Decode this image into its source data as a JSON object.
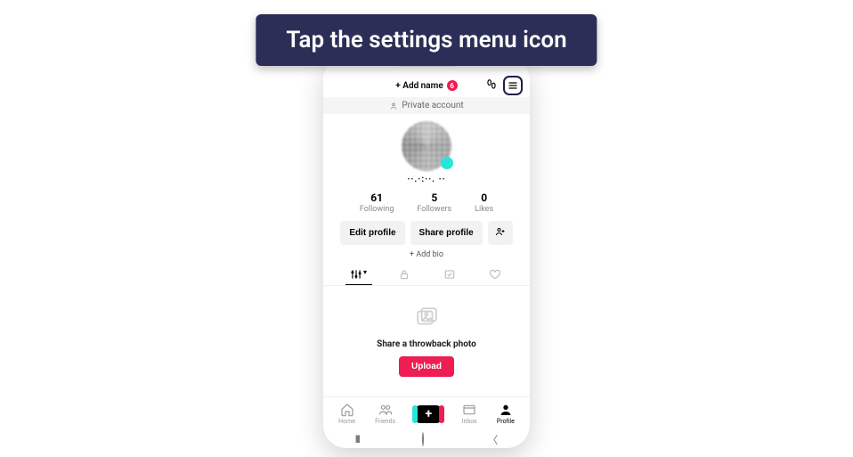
{
  "instruction": "Tap the settings menu icon",
  "header": {
    "add_name_label": "+ Add name",
    "badge_count": "6"
  },
  "private_label": "Private account",
  "username": "··.·:··. ··",
  "stats": {
    "following": {
      "num": "61",
      "label": "Following"
    },
    "followers": {
      "num": "5",
      "label": "Followers"
    },
    "likes": {
      "num": "0",
      "label": "Likes"
    }
  },
  "actions": {
    "edit": "Edit profile",
    "share": "Share profile",
    "add_bio": "+ Add bio"
  },
  "empty": {
    "message": "Share a throwback photo",
    "upload": "Upload"
  },
  "nav": {
    "home": "Home",
    "friends": "Friends",
    "inbox": "Inbox",
    "profile": "Profile"
  }
}
